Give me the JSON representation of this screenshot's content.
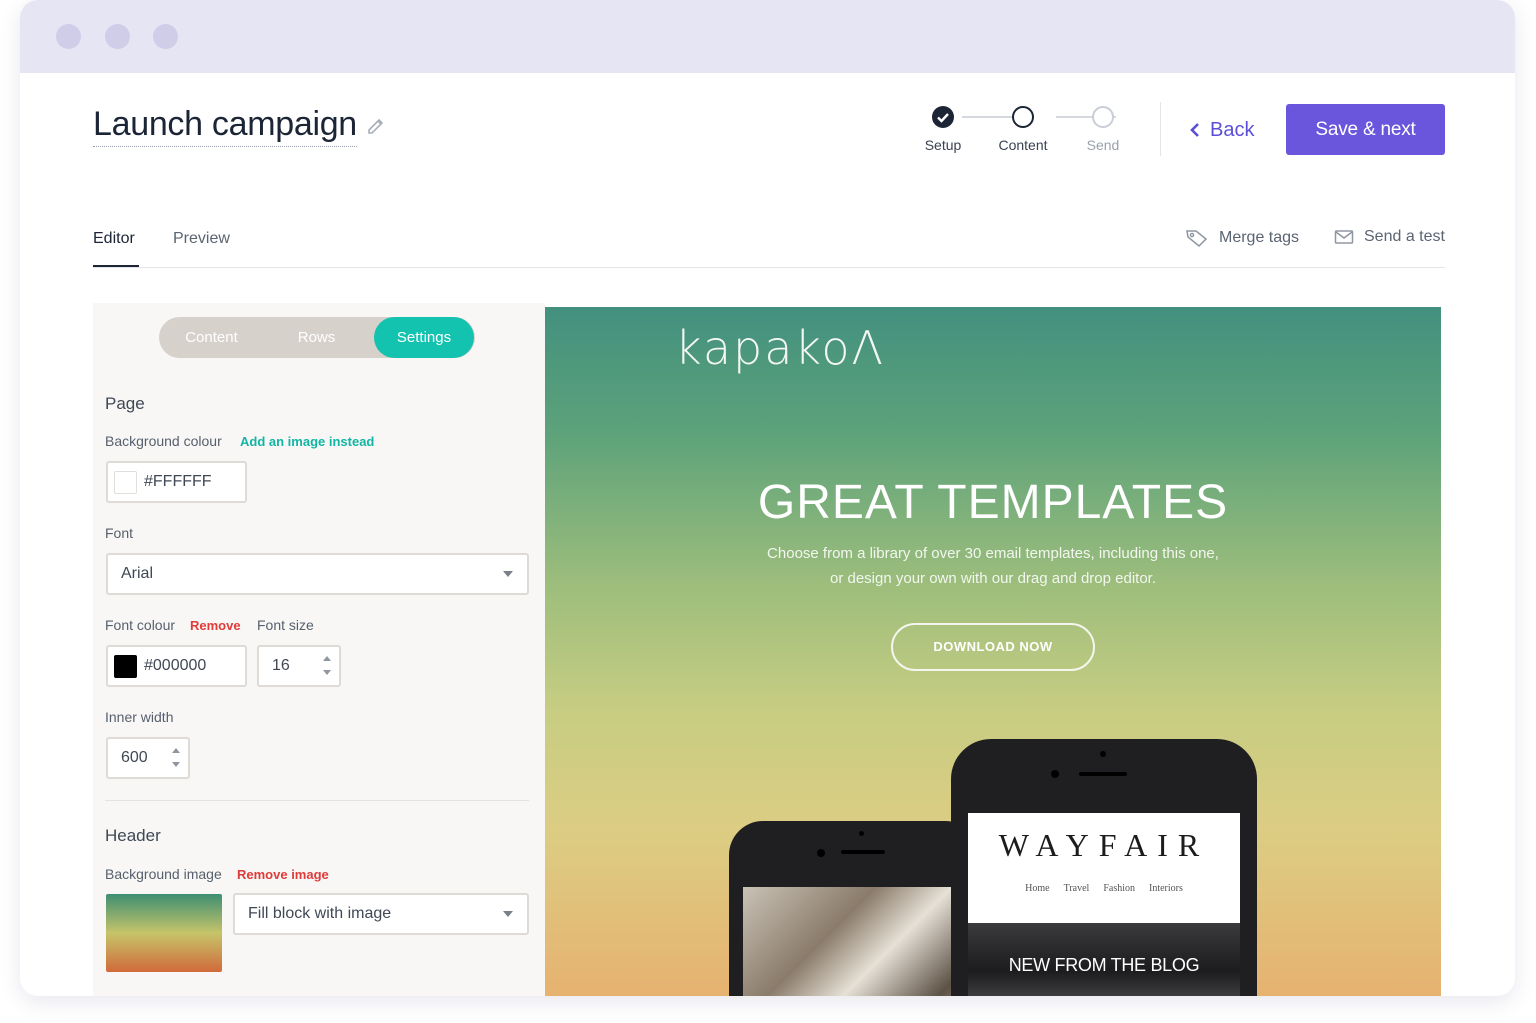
{
  "header": {
    "title": "Launch campaign",
    "back_label": "Back",
    "save_label": "Save & next"
  },
  "stepper": {
    "steps": [
      {
        "label": "Setup",
        "state": "done"
      },
      {
        "label": "Content",
        "state": "current"
      },
      {
        "label": "Send",
        "state": "upcoming"
      }
    ]
  },
  "tabs": {
    "items": [
      "Editor",
      "Preview"
    ],
    "active": "Editor",
    "merge_tags_label": "Merge tags",
    "send_test_label": "Send a test"
  },
  "sidebar": {
    "segments": [
      "Content",
      "Rows",
      "Settings"
    ],
    "active_segment": "Settings",
    "page": {
      "heading": "Page",
      "bg_colour_label": "Background colour",
      "add_image_link": "Add an image instead",
      "bg_colour_value": "#FFFFFF",
      "font_label": "Font",
      "font_value": "Arial",
      "font_colour_label": "Font colour",
      "remove_link": "Remove",
      "font_colour_value": "#000000",
      "font_size_label": "Font size",
      "font_size_value": "16",
      "inner_width_label": "Inner width",
      "inner_width_value": "600"
    },
    "header_section": {
      "heading": "Header",
      "bg_image_label": "Background image",
      "remove_image_link": "Remove image",
      "fill_mode_value": "Fill block with image"
    }
  },
  "preview": {
    "brand": "kapakoΛ",
    "title": "GREAT TEMPLATES",
    "subtitle_line1": "Choose from a library of over 30 email templates, including this one,",
    "subtitle_line2": "or design your own with our drag and drop editor.",
    "cta_label": "DOWNLOAD NOW",
    "phone": {
      "logo": "WAYFAIR",
      "nav": [
        "Home",
        "Travel",
        "Fashion",
        "Interiors"
      ],
      "hero_text": "NEW FROM THE BLOG"
    }
  },
  "colors": {
    "accent": "#6a55dd",
    "teal": "#14c2b0",
    "danger": "#e03b3b",
    "text_dark": "#1b2535"
  },
  "icons": {
    "edit": "pencil-icon",
    "back": "chevron-left-icon",
    "merge_tags": "tag-icon",
    "send_test": "envelope-icon",
    "select": "chevron-down-icon",
    "stepper": "spin-stepper-icon"
  }
}
